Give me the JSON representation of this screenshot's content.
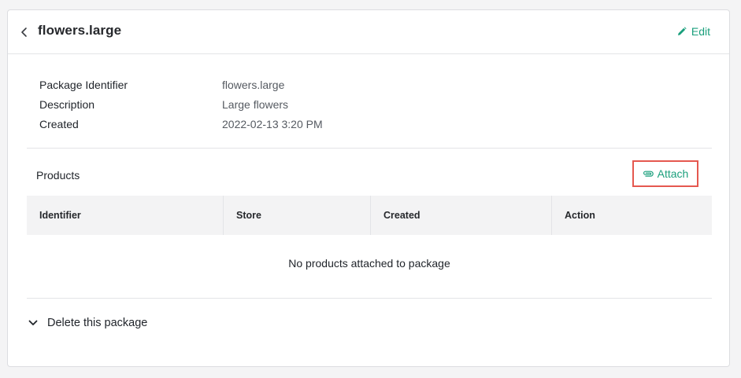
{
  "header": {
    "title": "flowers.large",
    "edit_label": "Edit",
    "accent_color": "#1a9f7c"
  },
  "details": [
    {
      "key": "Package Identifier",
      "value": "flowers.large"
    },
    {
      "key": "Description",
      "value": "Large flowers"
    },
    {
      "key": "Created",
      "value": "2022-02-13 3:20 PM"
    }
  ],
  "products": {
    "label": "Products",
    "attach_label": "Attach",
    "columns": [
      "Identifier",
      "Store",
      "Created",
      "Action"
    ],
    "rows": [],
    "empty_message": "No products attached to package"
  },
  "danger": {
    "delete_label": "Delete this package"
  },
  "icons": {
    "back": "chevron-left-icon",
    "edit": "pencil-icon",
    "attach": "paperclip-icon",
    "delete_toggle": "chevron-down-icon"
  }
}
